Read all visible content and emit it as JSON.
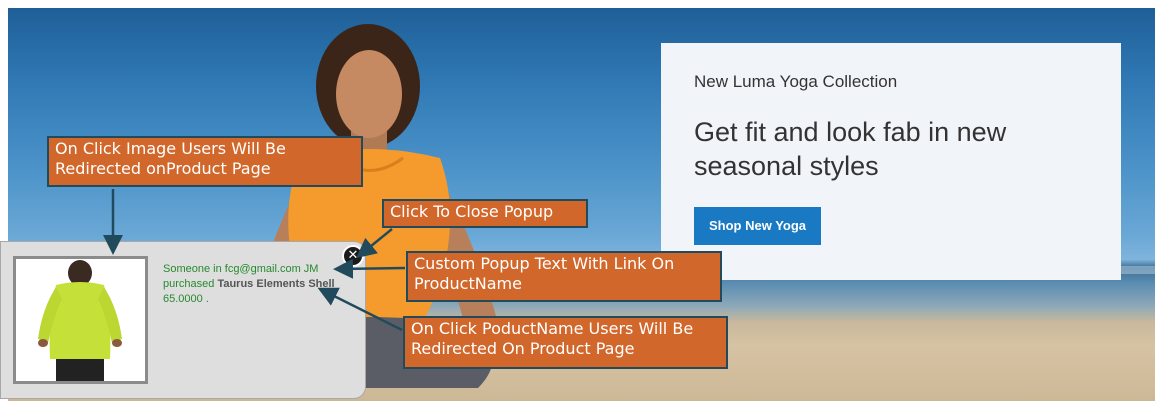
{
  "promo": {
    "subtitle": "New Luma Yoga Collection",
    "title": "Get fit and look fab in new seasonal styles",
    "button_label": "Shop New Yoga"
  },
  "popup": {
    "text_prefix": "Someone in fcg@gmail.com JM purchased ",
    "product_name": "Taurus Elements Shell",
    "price": " 65.0000 .",
    "close_symbol": "✕"
  },
  "annotations": {
    "image_click": "On Click Image Users Will Be Redirected onProduct Page",
    "close_popup": "Click To Close Popup",
    "custom_text": "Custom Popup Text With Link On ProductName",
    "product_click": "On Click PoductName Users Will Be Redirected On Product Page"
  },
  "colors": {
    "promo_button": "#1979c3",
    "callout_fill": "#d2672b",
    "callout_border": "#214b5c",
    "popup_text": "#268a2e"
  }
}
